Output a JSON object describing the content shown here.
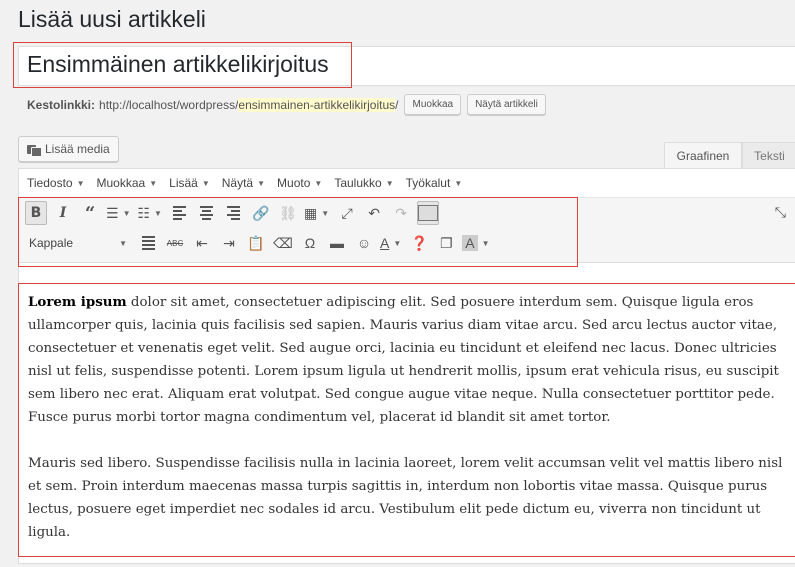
{
  "page": {
    "title": "Lisää uusi artikkeli"
  },
  "post": {
    "title": "Ensimmäinen artikkelikirjoitus",
    "permalink_label": "Kestolinkki:",
    "permalink_base": "http://localhost/wordpress/",
    "permalink_slug": "ensimmainen-artikkelikirjoitus",
    "permalink_trail": "/",
    "edit_button": "Muokkaa",
    "view_button": "Näytä artikkeli"
  },
  "media": {
    "add_media": "Lisää media"
  },
  "tabs": {
    "visual": "Graafinen",
    "text": "Teksti"
  },
  "menubar": [
    "Tiedosto",
    "Muokkaa",
    "Lisää",
    "Näytä",
    "Muoto",
    "Taulukko",
    "Työkalut"
  ],
  "toolbar": {
    "format_select": "Kappale",
    "text_color_label": "A",
    "bg_color_label": "A"
  },
  "content": {
    "p1_bold": "Lorem ipsum",
    "p1_rest": " dolor sit amet, consectetuer adipiscing elit. Sed posuere interdum sem. Quisque ligula eros ullamcorper quis, lacinia quis facilisis sed sapien. Mauris varius diam vitae arcu. Sed arcu lectus auctor vitae, consectetuer et venenatis eget velit. Sed augue orci, lacinia eu tincidunt et eleifend nec lacus. Donec ultricies nisl ut felis, suspendisse potenti. Lorem ipsum ligula ut hendrerit mollis, ipsum erat vehicula risus, eu suscipit sem libero nec erat. Aliquam erat volutpat. Sed congue augue vitae neque. Nulla consectetuer porttitor pede. Fusce purus morbi tortor magna condimentum vel, placerat id blandit sit amet tortor.",
    "p2": "Mauris sed libero. Suspendisse facilisis nulla in lacinia laoreet, lorem velit accumsan velit vel mattis libero nisl et sem. Proin interdum maecenas massa turpis sagittis in, interdum non lobortis vitae massa. Quisque purus lectus, posuere eget imperdiet nec sodales id arcu. Vestibulum elit pede dictum eu, viverra non tincidunt ut ligula."
  },
  "colors": {
    "highlight": "#d9443a",
    "slug_bg": "#fffbcc"
  }
}
